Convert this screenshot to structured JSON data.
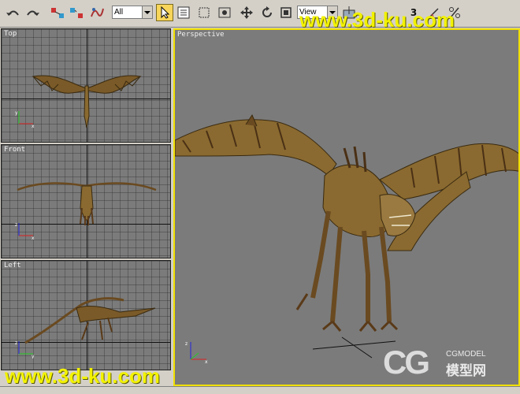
{
  "toolbar": {
    "filter_select": {
      "value": "All"
    },
    "reference_select": {
      "value": "View"
    },
    "icons": [
      "undo-icon",
      "redo-icon",
      "link-icon",
      "unlink-icon",
      "bind-space-warp-icon",
      "select-cursor-icon",
      "select-by-name-icon",
      "rectangular-selection-icon",
      "window-crossing-icon",
      "move-icon",
      "rotate-icon",
      "scale-icon",
      "pivot-icon",
      "snap-3-icon",
      "angle-snap-icon",
      "percent-snap-icon"
    ],
    "snap_label": "3"
  },
  "viewports": {
    "top": {
      "label": "Top"
    },
    "front": {
      "label": "Front"
    },
    "left": {
      "label": "Left"
    },
    "perspective": {
      "label": "Perspective"
    }
  },
  "watermark": {
    "top_text": "www.3d-ku.com",
    "bottom_text": "www.3d-ku.com"
  },
  "logo": {
    "main": "CG",
    "sub_top": "CGMODEL",
    "sub_bottom": "模型网"
  },
  "colors": {
    "active_border": "#f0e000",
    "viewport_bg": "#7b7b7b",
    "watermark": "#f2f200"
  }
}
